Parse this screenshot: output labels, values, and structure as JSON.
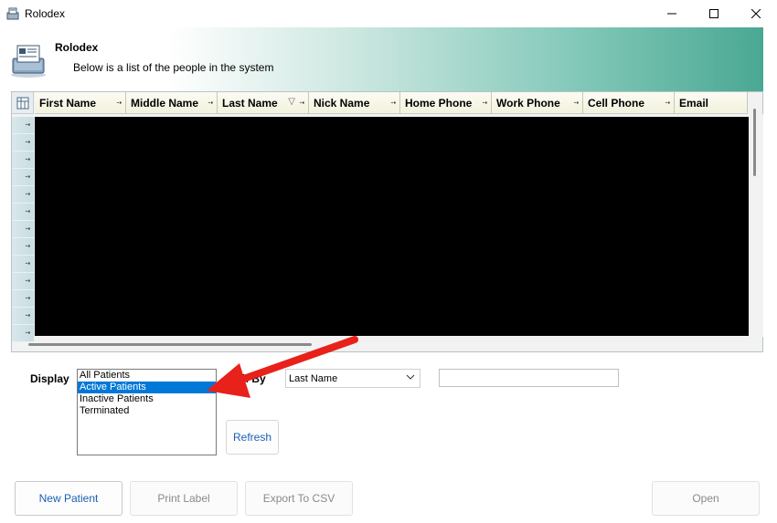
{
  "window": {
    "title": "Rolodex"
  },
  "banner": {
    "title": "Rolodex",
    "subtitle": "Below is a list of the people in the system"
  },
  "grid": {
    "columns": [
      "First Name",
      "Middle Name",
      "Last Name",
      "Nick Name",
      "Home Phone",
      "Work Phone",
      "Cell Phone",
      "Email"
    ],
    "sorted_column": "Last Name",
    "row_count_visible": 13,
    "row_glyph": "-⬝"
  },
  "display": {
    "label": "Display",
    "options": [
      "All Patients",
      "Active Patients",
      "Inactive Patients",
      "Terminated"
    ],
    "selected": "Active Patients"
  },
  "search": {
    "label": "ch By",
    "field_value": "Last Name",
    "text_value": ""
  },
  "buttons": {
    "refresh": "Refresh",
    "new_patient": "New Patient",
    "print_label": "Print Label",
    "export_csv": "Export To CSV",
    "open": "Open"
  },
  "colors": {
    "accent": "#4aa892",
    "selection": "#0078d7",
    "annotation_arrow": "#e8211a"
  },
  "icons": {
    "app": "rolodex-icon",
    "banner": "rolodex-card-icon",
    "grid_corner": "column-chooser-icon",
    "pin": "pin-icon"
  }
}
